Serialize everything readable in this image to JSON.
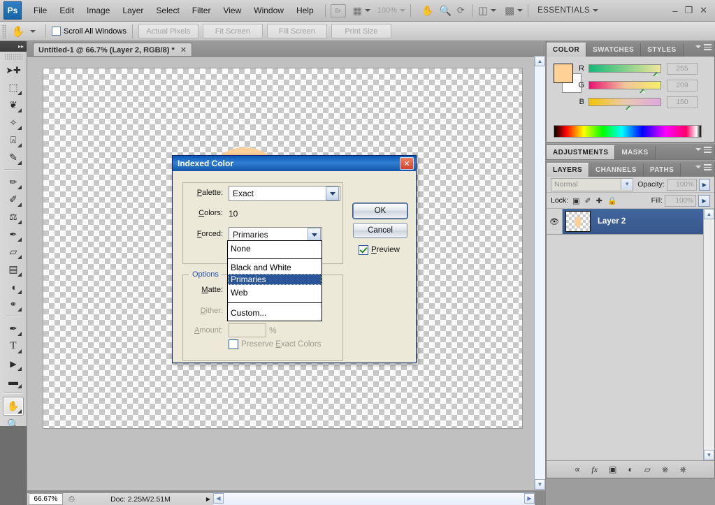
{
  "app": {
    "logo": "Ps",
    "workspace": "ESSENTIALS",
    "menus": [
      "File",
      "Edit",
      "Image",
      "Layer",
      "Select",
      "Filter",
      "View",
      "Window",
      "Help"
    ],
    "bridge_label": "Br",
    "zoom_menu_label": "100%",
    "window_buttons": {
      "minimize": "–",
      "restore": "❐",
      "close": "✕"
    }
  },
  "options_bar": {
    "tool_icon": "hand-tool",
    "scroll_all_windows_label": "Scroll All Windows",
    "scroll_all_windows_checked": false,
    "buttons": [
      "Actual Pixels",
      "Fit Screen",
      "Fill Screen",
      "Print Size"
    ]
  },
  "toolbox": {
    "tools": [
      {
        "name": "move-tool",
        "glyph": "➤",
        "selected": false
      },
      {
        "name": "rectangular-marquee-tool",
        "glyph": "⬚",
        "selected": false
      },
      {
        "name": "lasso-tool",
        "glyph": "✠",
        "selected": false
      },
      {
        "name": "magic-wand-tool",
        "glyph": "✦",
        "selected": false
      },
      {
        "name": "crop-tool",
        "glyph": "⌗",
        "selected": false
      },
      {
        "name": "eyedropper-tool",
        "glyph": "✒",
        "selected": false
      },
      {
        "name": "healing-brush-tool",
        "glyph": "✐",
        "selected": false
      },
      {
        "name": "brush-tool",
        "glyph": "✎",
        "selected": false
      },
      {
        "name": "clone-stamp-tool",
        "glyph": "⚒",
        "selected": false
      },
      {
        "name": "history-brush-tool",
        "glyph": "↙",
        "selected": false
      },
      {
        "name": "eraser-tool",
        "glyph": "▱",
        "selected": false
      },
      {
        "name": "gradient-tool",
        "glyph": "▤",
        "selected": false
      },
      {
        "name": "blur-tool",
        "glyph": "◖",
        "selected": false
      },
      {
        "name": "dodge-tool",
        "glyph": "⚲",
        "selected": false
      },
      {
        "name": "pen-tool",
        "glyph": "✒",
        "selected": false
      },
      {
        "name": "type-tool",
        "glyph": "T",
        "selected": false
      },
      {
        "name": "path-selection-tool",
        "glyph": "▶",
        "selected": false
      },
      {
        "name": "rectangle-tool",
        "glyph": "▬",
        "selected": false
      },
      {
        "name": "hand-tool",
        "glyph": "✋",
        "selected": true
      },
      {
        "name": "zoom-tool",
        "glyph": "⚲",
        "selected": false
      }
    ],
    "foreground_color": "#ffd196",
    "background_color": "#ffffff",
    "quickmask_glyph": "◯"
  },
  "document": {
    "tab_title": "Untitled-1 @ 66.7% (Layer 2, RGB/8) *",
    "close_glyph": "✕",
    "status": {
      "zoom": "66.67%",
      "doc_label": "Doc: 2.25M/2.51M"
    },
    "artwork": {
      "sun_color": "#ffd09a"
    }
  },
  "panels": {
    "color": {
      "tabs": [
        {
          "label": "COLOR",
          "active": true
        },
        {
          "label": "SWATCHES",
          "active": false
        },
        {
          "label": "STYLES",
          "active": false
        }
      ],
      "channels": [
        {
          "label": "R",
          "value": "255",
          "thumb_pct": 98
        },
        {
          "label": "G",
          "value": "209",
          "thumb_pct": 80
        },
        {
          "label": "B",
          "value": "150",
          "thumb_pct": 58
        }
      ],
      "foreground": "#ffd196",
      "background": "#ffffff"
    },
    "adjustments": {
      "tabs": [
        {
          "label": "ADJUSTMENTS",
          "active": true
        },
        {
          "label": "MASKS",
          "active": false
        }
      ]
    },
    "layers": {
      "tabs": [
        {
          "label": "LAYERS",
          "active": true
        },
        {
          "label": "CHANNELS",
          "active": false
        },
        {
          "label": "PATHS",
          "active": false
        }
      ],
      "blend_mode": "Normal",
      "opacity_label": "Opacity:",
      "opacity_value": "100%",
      "lock_label": "Lock:",
      "lock_icons": [
        "lock-transparency-icon",
        "lock-image-icon",
        "lock-position-icon",
        "lock-all-icon"
      ],
      "fill_label": "Fill:",
      "fill_value": "100%",
      "items": [
        {
          "name": "Layer 2",
          "visible": true,
          "selected": true
        }
      ],
      "bottom_icons": [
        {
          "name": "link-layers-icon",
          "glyph": "⚭"
        },
        {
          "name": "layer-style-icon",
          "glyph": "fx"
        },
        {
          "name": "layer-mask-icon",
          "glyph": "▣"
        },
        {
          "name": "adjustment-layer-icon",
          "glyph": "◑"
        },
        {
          "name": "new-group-icon",
          "glyph": "▱"
        },
        {
          "name": "new-layer-icon",
          "glyph": "⧉"
        },
        {
          "name": "delete-layer-icon",
          "glyph": "Ὕ1"
        }
      ]
    }
  },
  "dialog": {
    "title": "Indexed Color",
    "close_glyph": "✕",
    "fields": {
      "palette_label": "Palette:",
      "palette_value": "Exact",
      "colors_label": "Colors:",
      "colors_value": "10",
      "forced_label": "Forced:",
      "forced_value": "Primaries"
    },
    "forced_dropdown": {
      "open": true,
      "items": [
        {
          "label": "None",
          "selected": false,
          "separator_after": true
        },
        {
          "label": "Black and White",
          "selected": false,
          "separator_after": false
        },
        {
          "label": "Primaries",
          "selected": true,
          "separator_after": false
        },
        {
          "label": "Web",
          "selected": false,
          "separator_after": true
        },
        {
          "label": "Custom...",
          "selected": false,
          "separator_after": false
        }
      ]
    },
    "options_group": {
      "legend": "Options",
      "matte_label": "Matte:",
      "matte_value": "",
      "dither_label": "Dither:",
      "dither_value": "",
      "amount_label": "Amount:",
      "amount_value": "",
      "percent_sign": "%",
      "preserve_label": "Preserve Exact Colors",
      "preserve_checked": false
    },
    "buttons": {
      "ok": "OK",
      "cancel": "Cancel",
      "preview_label": "Preview",
      "preview_checked": true
    }
  }
}
